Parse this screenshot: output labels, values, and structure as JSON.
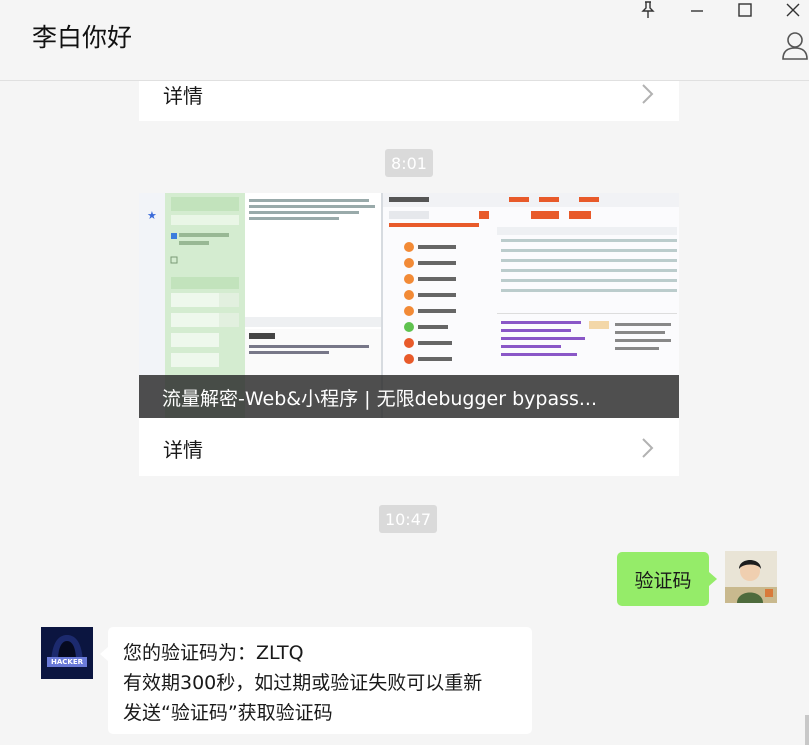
{
  "header": {
    "title": "李白你好"
  },
  "cards": [
    {
      "detail_label": "详情"
    },
    {
      "caption": "流量解密-Web&小程序 | 无限debugger bypass...",
      "detail_label": "详情"
    }
  ],
  "timestamps": [
    "8:01",
    "10:47"
  ],
  "messages": {
    "mine": {
      "text": "验证码"
    },
    "theirs": {
      "lines": [
        "您的验证码为：ZLTQ",
        "有效期300秒，如过期或验证失败可以重新",
        "发送“验证码”获取验证码"
      ]
    }
  },
  "avatar_them_text": "HACKER",
  "colors": {
    "background": "#f5f5f5",
    "my_bubble": "#95ec69",
    "their_bubble": "#ffffff",
    "timestamp_bg": "#dadada"
  },
  "icons": [
    "pin-icon",
    "minimize-icon",
    "maximize-icon",
    "close-icon",
    "person-icon",
    "chevron-right-icon"
  ]
}
